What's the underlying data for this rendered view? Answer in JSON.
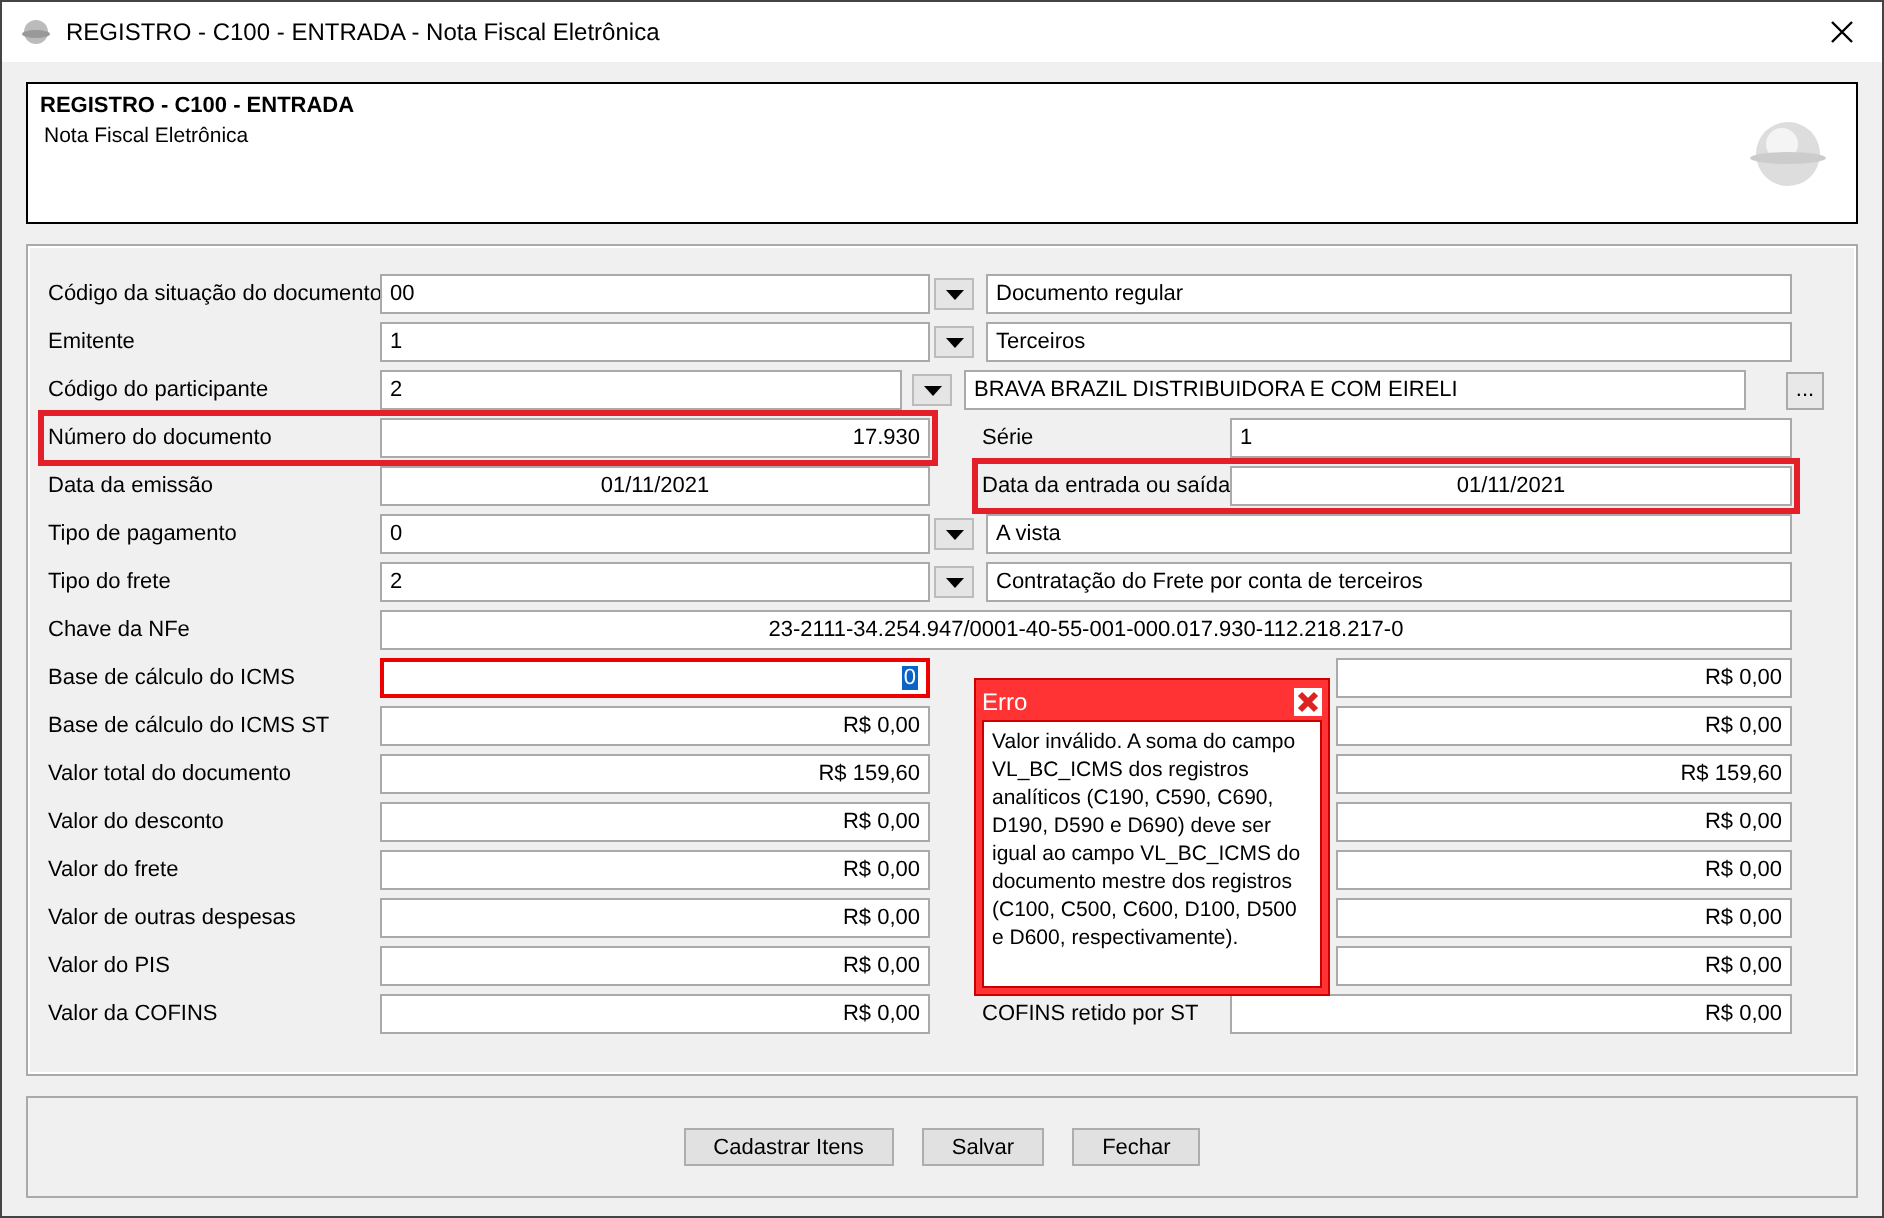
{
  "window": {
    "title": "REGISTRO - C100 - ENTRADA - Nota Fiscal Eletrônica"
  },
  "header": {
    "title": "REGISTRO - C100 - ENTRADA",
    "subtitle": "Nota Fiscal Eletrônica"
  },
  "rows": [
    {
      "kind": "combo",
      "label": "Código da situação do documento",
      "code": "00",
      "description": "Documento regular"
    },
    {
      "kind": "combo",
      "label": "Emitente",
      "code": "1",
      "description": "Terceiros"
    },
    {
      "kind": "participant",
      "label": "Código do participante",
      "code": "2",
      "description": "BRAVA BRAZIL DISTRIBUIDORA E COM EIRELI",
      "browse": "..."
    },
    {
      "kind": "pair",
      "label": "Número do documento",
      "left": {
        "kind": "number",
        "text": "17.930"
      },
      "error": true,
      "right_label": "Série",
      "right": {
        "kind": "text",
        "text": "1"
      },
      "right_error": false
    },
    {
      "kind": "pair",
      "label": "Data da emissão",
      "left": {
        "kind": "date",
        "text": "01/11/2021"
      },
      "error": false,
      "right_label": "Data da entrada ou saída",
      "right": {
        "kind": "date",
        "text": "01/11/2021"
      },
      "right_error": true
    },
    {
      "kind": "combo",
      "label": "Tipo de pagamento",
      "code": "0",
      "description": "A vista"
    },
    {
      "kind": "combo",
      "label": "Tipo do frete",
      "code": "2",
      "description": "Contratação do Frete por conta de terceiros"
    },
    {
      "kind": "wide",
      "label": "Chave da NFe",
      "value": "23-2111-34.254.947/0001-40-55-001-000.017.930-112.218.217-0"
    },
    {
      "kind": "pair",
      "label": "Base de cálculo do ICMS",
      "left": {
        "kind": "number",
        "text": "0"
      },
      "focused": true,
      "right": {
        "kind": "number",
        "text": "R$ 0,00"
      }
    },
    {
      "kind": "pair",
      "label": "Base de cálculo do ICMS ST",
      "left": {
        "kind": "number",
        "text": "R$ 0,00"
      },
      "right": {
        "kind": "number",
        "text": "R$ 0,00"
      }
    },
    {
      "kind": "pair",
      "label": "Valor total do documento",
      "left": {
        "kind": "number",
        "text": "R$ 159,60"
      },
      "right": {
        "kind": "number",
        "text": "R$ 159,60"
      }
    },
    {
      "kind": "pair",
      "label": "Valor do desconto",
      "left": {
        "kind": "number",
        "text": "R$ 0,00"
      },
      "right": {
        "kind": "number",
        "text": "R$ 0,00"
      }
    },
    {
      "kind": "pair",
      "label": "Valor do frete",
      "left": {
        "kind": "number",
        "text": "R$ 0,00"
      },
      "right": {
        "kind": "number",
        "text": "R$ 0,00"
      }
    },
    {
      "kind": "pair",
      "label": "Valor de outras despesas",
      "left": {
        "kind": "number",
        "text": "R$ 0,00"
      },
      "right": {
        "kind": "number",
        "text": "R$ 0,00"
      }
    },
    {
      "kind": "pair",
      "label": "Valor do PIS",
      "left": {
        "kind": "number",
        "text": "R$ 0,00"
      },
      "right": {
        "kind": "number",
        "text": "R$ 0,00"
      }
    },
    {
      "kind": "pair",
      "label": "Valor da COFINS",
      "left": {
        "kind": "number",
        "text": "R$ 0,00"
      },
      "right_label": "COFINS retido por ST",
      "right": {
        "kind": "number",
        "text": "R$ 0,00"
      }
    }
  ],
  "error_popup": {
    "title": "Erro",
    "message": "Valor inválido. A soma do campo VL_BC_ICMS dos registros analíticos (C190, C590, C690, D190, D590 e D690) deve ser igual ao campo VL_BC_ICMS do documento mestre dos registros (C100, C500, C600, D100, D500 e D600, respectivamente)."
  },
  "buttons": [
    "Cadastrar Itens",
    "Salvar",
    "Fechar"
  ]
}
